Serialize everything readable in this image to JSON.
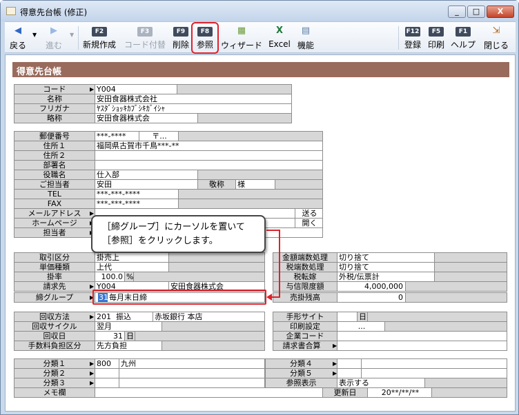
{
  "window": {
    "title": "得意先台帳 (修正)",
    "min": "_",
    "max": "□",
    "close": "X"
  },
  "toolbar": {
    "back": "戻る",
    "forward": "進む",
    "f2": "F2",
    "new": "新規作成",
    "f3": "F3",
    "code_reassign": "コード付替",
    "f9": "F9",
    "delete": "削除",
    "f8": "F8",
    "reference": "参照",
    "wizard": "ウィザード",
    "excel": "Excel",
    "function": "機能",
    "f12": "F12",
    "register": "登録",
    "f5": "F5",
    "print": "印刷",
    "f1": "F1",
    "help": "ヘルプ",
    "close": "閉じる"
  },
  "section_title": "得意先台帳",
  "basic": {
    "code_label": "コード",
    "code": "Y004",
    "name_label": "名称",
    "name": "安田食器株式会社",
    "kana_label": "フリガナ",
    "kana": "ﾔｽﾀﾞｼｮｯｷｶﾌﾞｼｷｶﾞｲｼｬ",
    "short_label": "略称",
    "short": "安田食器株式会"
  },
  "address": {
    "zip_label": "郵便番号",
    "zip": "***-****",
    "zip_btn": "〒...",
    "addr1_label": "住所１",
    "addr1": "福岡県古賀市千鳥***-**",
    "addr2_label": "住所２",
    "dept_label": "部署名",
    "title_label": "役職名",
    "title": "仕入部",
    "contact_label": "ご担当者",
    "contact": "安田",
    "honor_label": "敬称",
    "honor": "様",
    "tel_label": "TEL",
    "tel": "***-***-****",
    "fax_label": "FAX",
    "fax": "***-***-****",
    "mail_label": "メールアドレス",
    "mail_btn": "送る",
    "home_label": "ホームページ",
    "home_btn": "開く",
    "staff_label": "担当者"
  },
  "trade": {
    "type_label": "取引区分",
    "type": "掛売上",
    "price_label": "単価種類",
    "price": "上代",
    "rate_label": "掛率",
    "rate": "100.0",
    "rate_unit": "%",
    "bill_label": "請求先",
    "bill_code": "Y004",
    "bill_name": "安田食器株式会",
    "close_label": "締グループ",
    "close_code": "31",
    "close_name": "毎月末日締",
    "round_label": "金額端数処理",
    "round": "切り捨て",
    "tax_round_label": "税端数処理",
    "tax_round": "切り捨て",
    "tax_label": "税転嫁",
    "tax": "外税/伝票計",
    "credit_label": "与信限度額",
    "credit": "4,000,000",
    "ar_label": "売掛残高",
    "ar": "0"
  },
  "collect": {
    "method_label": "回収方法",
    "method_code": "201",
    "method": "振込",
    "bank": "赤坂銀行 本店",
    "cycle_label": "回収サイクル",
    "cycle": "翌月",
    "day_label": "回収日",
    "day": "31",
    "day_unit": "日",
    "fee_label": "手数料負担区分",
    "fee": "先方負担",
    "note_label": "手形サイト",
    "note_unit": "日",
    "print_label": "印刷設定",
    "print_btn": "...",
    "corp_label": "企業コード",
    "invoice_label": "請求書合算"
  },
  "classify": {
    "c1_label": "分類１",
    "c1_code": "800",
    "c1": "九州",
    "c2_label": "分類２",
    "c3_label": "分類３",
    "c4_label": "分類４",
    "c5_label": "分類５",
    "show_label": "参照表示",
    "show": "表示する",
    "memo_label": "メモ欄",
    "updated_label": "更新日",
    "updated": "20**/**/**"
  },
  "callout": {
    "line1": "［締グループ］にカーソルを置いて",
    "line2": "［参照］をクリックします。"
  },
  "colors": {
    "header": "#996b5c",
    "label_bg": "#d7d7d7",
    "highlight": "#e0202a",
    "selection": "#3c77d2"
  }
}
